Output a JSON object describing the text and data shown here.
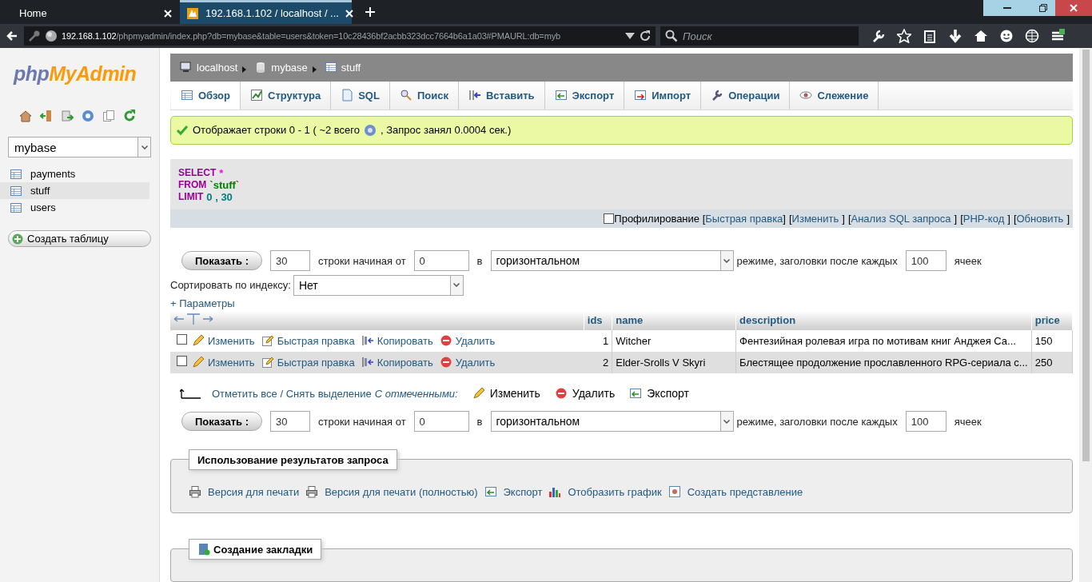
{
  "browser": {
    "tabs": [
      {
        "label": "Home",
        "selected": false
      },
      {
        "label": "192.168.1.102 / localhost / ...",
        "selected": true
      }
    ],
    "url": {
      "host": "192.168.1.102",
      "path": "/phpmyadmin/index.php?db=mybase&table=users&token=10c28436bf2acbb323dcc7664b6a1a03#PMAURL:db=myb"
    },
    "search": {
      "placeholder": "Поиск"
    }
  },
  "sidebar": {
    "logo": {
      "first": "php",
      "second": "MyAdmin"
    },
    "database": "mybase",
    "tables": [
      {
        "name": "payments",
        "selected": false
      },
      {
        "name": "stuff",
        "selected": true
      },
      {
        "name": "users",
        "selected": false
      }
    ],
    "create_button": "Создать таблицу"
  },
  "breadcrumb": [
    {
      "label": "localhost",
      "kind": "server"
    },
    {
      "label": "mybase",
      "kind": "database"
    },
    {
      "label": "stuff",
      "kind": "table"
    }
  ],
  "tabs": [
    {
      "label": "Обзор",
      "kind": "browse",
      "selected": true
    },
    {
      "label": "Структура",
      "kind": "structure",
      "selected": false
    },
    {
      "label": "SQL",
      "kind": "sql",
      "selected": false
    },
    {
      "label": "Поиск",
      "kind": "search",
      "selected": false
    },
    {
      "label": "Вставить",
      "kind": "insert",
      "selected": false
    },
    {
      "label": "Экспорт",
      "kind": "export",
      "selected": false
    },
    {
      "label": "Импорт",
      "kind": "import",
      "selected": false
    },
    {
      "label": "Операции",
      "kind": "operations",
      "selected": false
    },
    {
      "label": "Слежение",
      "kind": "tracking",
      "selected": false
    }
  ],
  "message": {
    "before_help": "Отображает строки 0 - 1 ( ~2 всего",
    "after_help": ", Запрос занял 0.0004 сек.)"
  },
  "sql": [
    {
      "keyword": "SELECT",
      "value": "*",
      "color": "#ff00ff"
    },
    {
      "keyword": "FROM",
      "value": "`stuff`",
      "color": "#008000"
    },
    {
      "keyword": "LIMIT",
      "value": "0 , 30",
      "color": "#008080"
    }
  ],
  "sql_actions": {
    "profiling": {
      "label": "Профилирование",
      "checked": false
    },
    "links": [
      "Быстрая правка",
      "Изменить",
      "Анализ SQL запроса",
      "PHP-код",
      "Обновить"
    ],
    "open_bracket": "[",
    "close_bracket": "]"
  },
  "navigation_top": {
    "button": "Показать :",
    "rows": "30",
    "rows_label": "строки начиная от",
    "start": "0",
    "in_label": "в",
    "mode": "горизонтальном",
    "mode_label": "режиме, заголовки после каждых",
    "repeat": "100",
    "repeat_label": "ячеек"
  },
  "sort": {
    "label": "Сортировать по индексу:",
    "value": "Нет"
  },
  "options_link": "+ Параметры",
  "table": {
    "columns": [
      "ids",
      "name",
      "description",
      "price"
    ],
    "rows": [
      {
        "checked": false,
        "actions": [
          {
            "label": "Изменить",
            "kind": "edit"
          },
          {
            "label": "Быстрая правка",
            "kind": "inline"
          },
          {
            "label": "Копировать",
            "kind": "copy"
          },
          {
            "label": "Удалить",
            "kind": "delete"
          }
        ],
        "cells": [
          "1",
          "Witcher",
          "Фентезийная ролевая игра по мотивам книг Анджея Са...",
          "150"
        ]
      },
      {
        "checked": false,
        "actions": [
          {
            "label": "Изменить",
            "kind": "edit"
          },
          {
            "label": "Быстрая правка",
            "kind": "inline"
          },
          {
            "label": "Копировать",
            "kind": "copy"
          },
          {
            "label": "Удалить",
            "kind": "delete"
          }
        ],
        "cells": [
          "2",
          "Elder-Srolls V Skyri",
          "Блестящее продолжение прославленного RPG-сериала с...",
          "250"
        ]
      }
    ]
  },
  "bulk": {
    "check_all": "Отметить все / Снять выделение",
    "with_selected": "С отмеченными:",
    "actions": [
      {
        "label": "Изменить",
        "kind": "edit"
      },
      {
        "label": "Удалить",
        "kind": "delete"
      },
      {
        "label": "Экспорт",
        "kind": "export"
      }
    ]
  },
  "navigation_bottom": {
    "button": "Показать :",
    "rows": "30",
    "rows_label": "строки начиная от",
    "start": "0",
    "in_label": "в",
    "mode": "горизонтальном",
    "mode_label": "режиме, заголовки после каждых",
    "repeat": "100",
    "repeat_label": "ячеек"
  },
  "query_results": {
    "legend": "Использование результатов запроса",
    "links": [
      {
        "label": "Версия для печати",
        "kind": "print"
      },
      {
        "label": "Версия для печати (полностью)",
        "kind": "print"
      },
      {
        "label": "Экспорт",
        "kind": "export"
      },
      {
        "label": "Отобразить график",
        "kind": "chart"
      },
      {
        "label": "Создать представление",
        "kind": "view"
      }
    ]
  },
  "bookmark": {
    "legend": "Создание закладки"
  }
}
